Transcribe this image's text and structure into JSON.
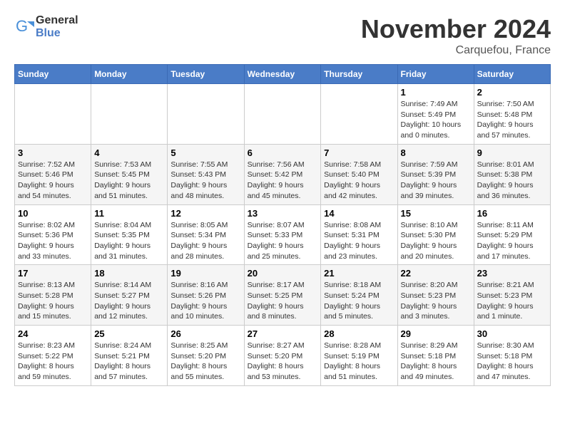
{
  "logo": {
    "general": "General",
    "blue": "Blue"
  },
  "header": {
    "month": "November 2024",
    "location": "Carquefou, France"
  },
  "weekdays": [
    "Sunday",
    "Monday",
    "Tuesday",
    "Wednesday",
    "Thursday",
    "Friday",
    "Saturday"
  ],
  "weeks": [
    [
      {
        "day": "",
        "detail": ""
      },
      {
        "day": "",
        "detail": ""
      },
      {
        "day": "",
        "detail": ""
      },
      {
        "day": "",
        "detail": ""
      },
      {
        "day": "",
        "detail": ""
      },
      {
        "day": "1",
        "detail": "Sunrise: 7:49 AM\nSunset: 5:49 PM\nDaylight: 10 hours and 0 minutes."
      },
      {
        "day": "2",
        "detail": "Sunrise: 7:50 AM\nSunset: 5:48 PM\nDaylight: 9 hours and 57 minutes."
      }
    ],
    [
      {
        "day": "3",
        "detail": "Sunrise: 7:52 AM\nSunset: 5:46 PM\nDaylight: 9 hours and 54 minutes."
      },
      {
        "day": "4",
        "detail": "Sunrise: 7:53 AM\nSunset: 5:45 PM\nDaylight: 9 hours and 51 minutes."
      },
      {
        "day": "5",
        "detail": "Sunrise: 7:55 AM\nSunset: 5:43 PM\nDaylight: 9 hours and 48 minutes."
      },
      {
        "day": "6",
        "detail": "Sunrise: 7:56 AM\nSunset: 5:42 PM\nDaylight: 9 hours and 45 minutes."
      },
      {
        "day": "7",
        "detail": "Sunrise: 7:58 AM\nSunset: 5:40 PM\nDaylight: 9 hours and 42 minutes."
      },
      {
        "day": "8",
        "detail": "Sunrise: 7:59 AM\nSunset: 5:39 PM\nDaylight: 9 hours and 39 minutes."
      },
      {
        "day": "9",
        "detail": "Sunrise: 8:01 AM\nSunset: 5:38 PM\nDaylight: 9 hours and 36 minutes."
      }
    ],
    [
      {
        "day": "10",
        "detail": "Sunrise: 8:02 AM\nSunset: 5:36 PM\nDaylight: 9 hours and 33 minutes."
      },
      {
        "day": "11",
        "detail": "Sunrise: 8:04 AM\nSunset: 5:35 PM\nDaylight: 9 hours and 31 minutes."
      },
      {
        "day": "12",
        "detail": "Sunrise: 8:05 AM\nSunset: 5:34 PM\nDaylight: 9 hours and 28 minutes."
      },
      {
        "day": "13",
        "detail": "Sunrise: 8:07 AM\nSunset: 5:33 PM\nDaylight: 9 hours and 25 minutes."
      },
      {
        "day": "14",
        "detail": "Sunrise: 8:08 AM\nSunset: 5:31 PM\nDaylight: 9 hours and 23 minutes."
      },
      {
        "day": "15",
        "detail": "Sunrise: 8:10 AM\nSunset: 5:30 PM\nDaylight: 9 hours and 20 minutes."
      },
      {
        "day": "16",
        "detail": "Sunrise: 8:11 AM\nSunset: 5:29 PM\nDaylight: 9 hours and 17 minutes."
      }
    ],
    [
      {
        "day": "17",
        "detail": "Sunrise: 8:13 AM\nSunset: 5:28 PM\nDaylight: 9 hours and 15 minutes."
      },
      {
        "day": "18",
        "detail": "Sunrise: 8:14 AM\nSunset: 5:27 PM\nDaylight: 9 hours and 12 minutes."
      },
      {
        "day": "19",
        "detail": "Sunrise: 8:16 AM\nSunset: 5:26 PM\nDaylight: 9 hours and 10 minutes."
      },
      {
        "day": "20",
        "detail": "Sunrise: 8:17 AM\nSunset: 5:25 PM\nDaylight: 9 hours and 8 minutes."
      },
      {
        "day": "21",
        "detail": "Sunrise: 8:18 AM\nSunset: 5:24 PM\nDaylight: 9 hours and 5 minutes."
      },
      {
        "day": "22",
        "detail": "Sunrise: 8:20 AM\nSunset: 5:23 PM\nDaylight: 9 hours and 3 minutes."
      },
      {
        "day": "23",
        "detail": "Sunrise: 8:21 AM\nSunset: 5:23 PM\nDaylight: 9 hours and 1 minute."
      }
    ],
    [
      {
        "day": "24",
        "detail": "Sunrise: 8:23 AM\nSunset: 5:22 PM\nDaylight: 8 hours and 59 minutes."
      },
      {
        "day": "25",
        "detail": "Sunrise: 8:24 AM\nSunset: 5:21 PM\nDaylight: 8 hours and 57 minutes."
      },
      {
        "day": "26",
        "detail": "Sunrise: 8:25 AM\nSunset: 5:20 PM\nDaylight: 8 hours and 55 minutes."
      },
      {
        "day": "27",
        "detail": "Sunrise: 8:27 AM\nSunset: 5:20 PM\nDaylight: 8 hours and 53 minutes."
      },
      {
        "day": "28",
        "detail": "Sunrise: 8:28 AM\nSunset: 5:19 PM\nDaylight: 8 hours and 51 minutes."
      },
      {
        "day": "29",
        "detail": "Sunrise: 8:29 AM\nSunset: 5:18 PM\nDaylight: 8 hours and 49 minutes."
      },
      {
        "day": "30",
        "detail": "Sunrise: 8:30 AM\nSunset: 5:18 PM\nDaylight: 8 hours and 47 minutes."
      }
    ]
  ]
}
